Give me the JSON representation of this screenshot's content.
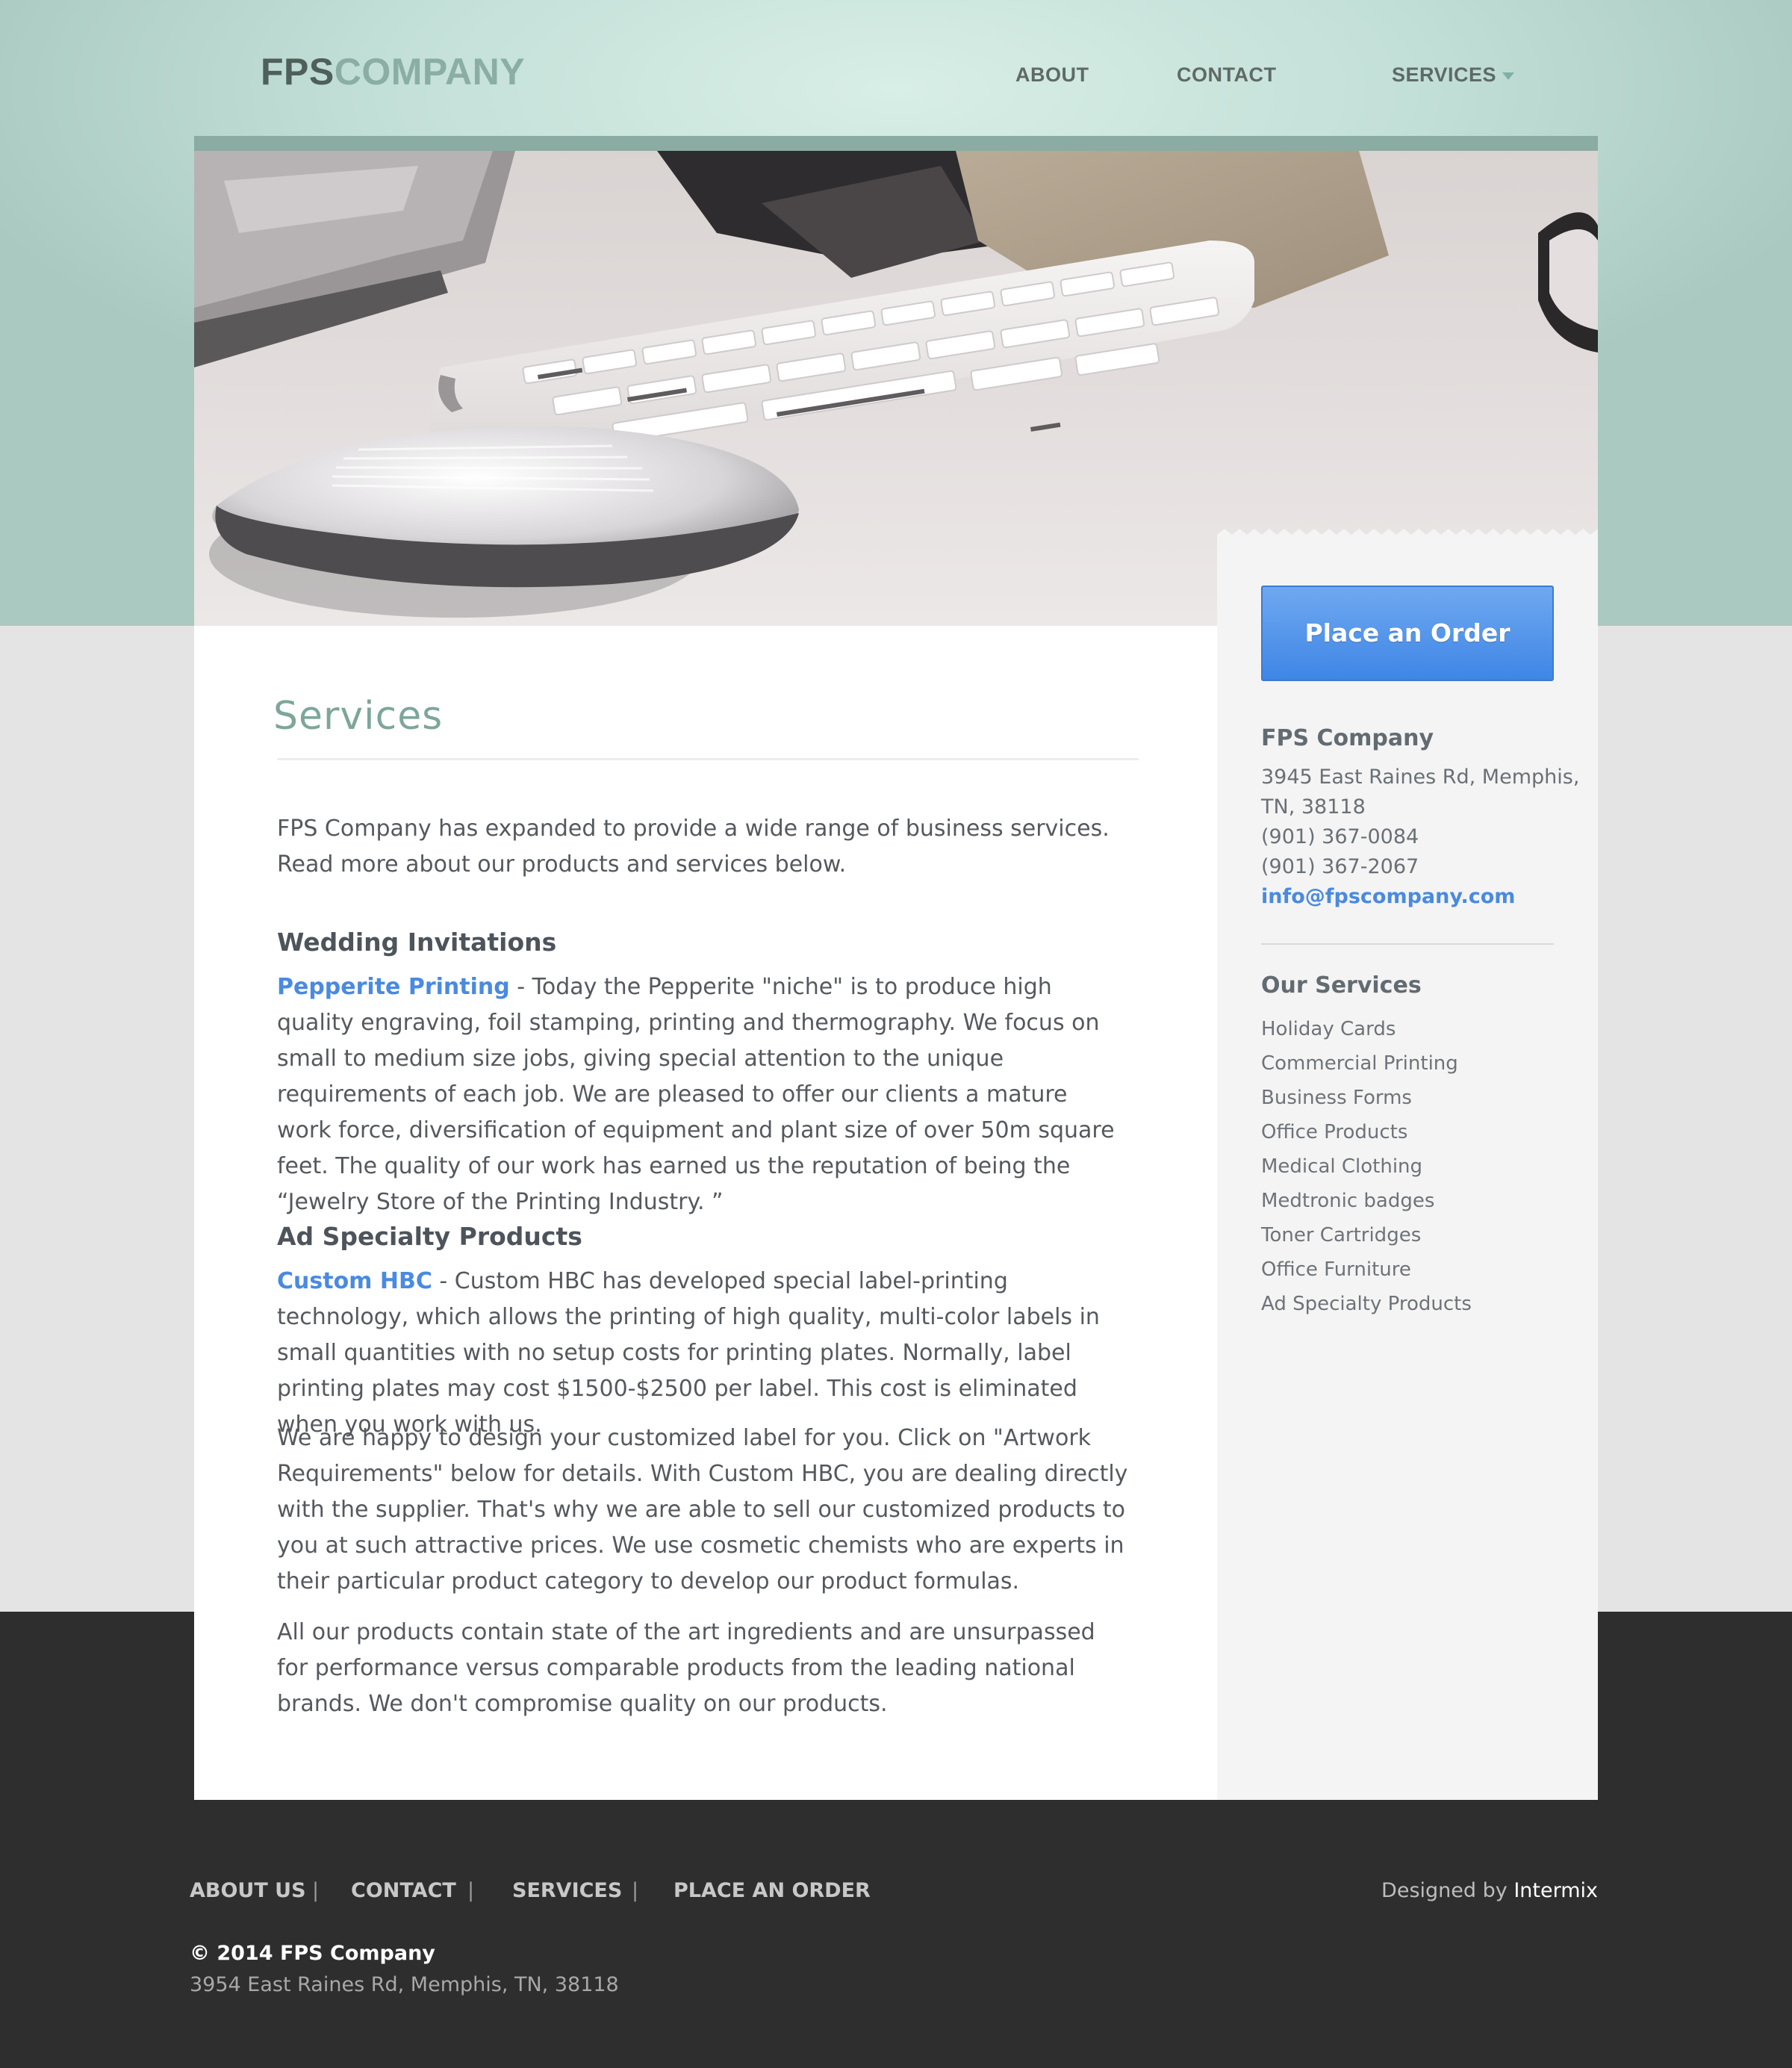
{
  "header": {
    "logo_part1": "FPS",
    "logo_part2": "COMPANY",
    "nav": {
      "about": "ABOUT",
      "contact": "CONTACT",
      "services": "SERVICES"
    }
  },
  "hero": {
    "icon": "desk-keyboard-mouse-photo"
  },
  "sidebar": {
    "order_button": "Place an Order",
    "company_title": "FPS Company",
    "address_line1": "3945 East Raines Rd, Memphis,",
    "address_line2": "TN, 38118",
    "phone1": "(901) 367-0084",
    "phone2": "(901) 367-2067",
    "email": "info@fpscompany.com",
    "services_title": "Our Services",
    "services": [
      "Holiday Cards",
      "Commercial Printing",
      "Business Forms",
      "Office Products",
      "Medical Clothing",
      "Medtronic badges",
      "Toner Cartridges",
      "Office Furniture",
      "Ad Specialty Products"
    ]
  },
  "main": {
    "title": "Services",
    "intro": "FPS Company has expanded to provide a wide range of business services. Read more about our products and services below.",
    "wedding": {
      "heading": "Wedding Invitations",
      "link": "Pepperite Printing",
      "text": " - Today the Pepperite \"niche\" is to produce high quality engraving, foil stamping, printing and thermography. We focus on small to medium size jobs, giving special attention to the unique requirements of each job. We are pleased to offer our clients a mature work force, diversification of equipment and plant size of over 50m square feet. The quality of our work has earned us the reputation of being the “Jewelry Store of the Printing Industry. ”"
    },
    "ad": {
      "heading": "Ad Specialty Products",
      "link": "Custom HBC",
      "text": " - Custom HBC has developed special label-printing technology, which allows the printing of high quality, multi-color labels in small quantities with no setup costs for printing plates. Normally, label printing plates may cost $1500-$2500 per label. This cost is eliminated when you work with us.",
      "para2": "We are happy to design your customized label for you. Click on \"Artwork Requirements\" below for details. With Custom HBC, you are dealing directly with the supplier. That's why we are able to sell our customized products to you at such attractive prices. We use cosmetic chemists who are experts in their particular product category to develop our product formulas.",
      "para3": "All our products contain state of the art ingredients and are unsurpassed for performance versus comparable products from the leading national brands. We don't compromise quality on our products."
    }
  },
  "footer": {
    "nav": [
      "ABOUT US",
      "CONTACT",
      "SERVICES",
      "PLACE AN ORDER"
    ],
    "separator": "|",
    "designed_by": "Designed by",
    "designer": "Intermix",
    "copyright": "© 2014 FPS Company",
    "address": "3954 East Raines Rd, Memphis, TN, 38118"
  },
  "colors": {
    "accent_blue": "#4a8ae0",
    "teal": "#8aaca2",
    "footer_bg": "#363636"
  }
}
